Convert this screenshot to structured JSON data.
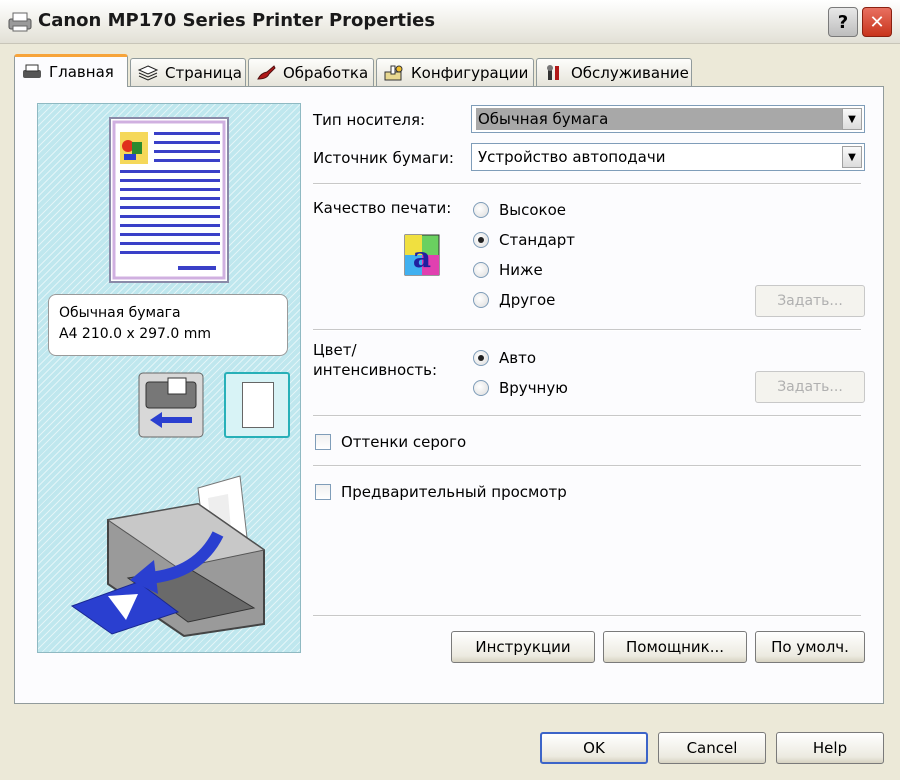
{
  "window": {
    "title": "Canon MP170 Series Printer Properties",
    "help_glyph": "?",
    "close_glyph": "✕"
  },
  "tabs": [
    {
      "label": "Главная",
      "icon": "printer-stack-icon",
      "active": true
    },
    {
      "label": "Страница",
      "icon": "layers-icon"
    },
    {
      "label": "Обработка",
      "icon": "brush-icon"
    },
    {
      "label": "Конфигурации",
      "icon": "config-icon"
    },
    {
      "label": "Обслуживание",
      "icon": "tools-icon"
    }
  ],
  "preview": {
    "media_line": "Обычная бумага",
    "size_line": "A4 210.0 x 297.0 mm"
  },
  "form": {
    "media_type_label": "Тип носителя:",
    "media_type_value": "Обычная бумага",
    "paper_source_label": "Источник бумаги:",
    "paper_source_value": "Устройство автоподачи",
    "quality_label": "Качество печати:",
    "quality_options": [
      "Высокое",
      "Стандарт",
      "Ниже",
      "Другое"
    ],
    "quality_selected": "Стандарт",
    "quality_set_button": "Задать...",
    "color_label_1": "Цвет/",
    "color_label_2": "интенсивность:",
    "color_options": [
      "Авто",
      "Вручную"
    ],
    "color_selected": "Авто",
    "color_set_button": "Задать...",
    "grayscale_label": "Оттенки серого",
    "preview_label": "Предварительный просмотр"
  },
  "panel_buttons": {
    "instructions": "Инструкции",
    "assistant": "Помощник...",
    "defaults": "По умолч."
  },
  "dialog_buttons": {
    "ok": "OK",
    "cancel": "Cancel",
    "help": "Help"
  },
  "colors": {
    "accent_tab": "#f7a43a",
    "preview_bg": "#bfe7ee",
    "arrow_blue": "#2a3fd0"
  }
}
